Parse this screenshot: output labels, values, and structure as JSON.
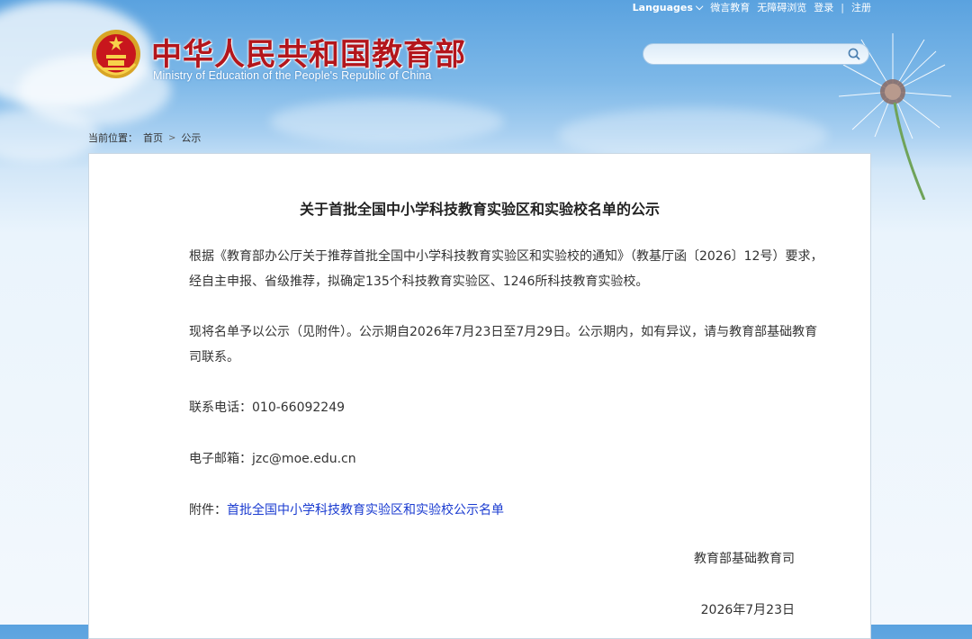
{
  "topbar": {
    "languages": "Languages",
    "weibo": "微言教育",
    "accessibility": "无障碍浏览",
    "login": "登录",
    "register": "注册"
  },
  "brand": {
    "name_cn": "中华人民共和国教育部",
    "name_en": "Ministry of Education of the People's Republic of China"
  },
  "search": {
    "placeholder": ""
  },
  "breadcrumb": {
    "prefix": "当前位置：",
    "home": "首页",
    "current": "公示"
  },
  "article": {
    "title": "关于首批全国中小学科技教育实验区和实验校名单的公示",
    "para1": "根据《教育部办公厅关于推荐首批全国中小学科技教育实验区和实验校的通知》（教基厅函〔2026〕12号）要求，经自主申报、省级推荐，拟确定135个科技教育实验区、1246所科技教育实验校。",
    "para2": "现将名单予以公示（见附件）。公示期自2026年7月23日至7月29日。公示期内，如有异议，请与教育部基础教育司联系。",
    "phone_label": "联系电话：",
    "phone": "010-66092249",
    "email_label": "电子邮箱：",
    "email": "jzc@moe.edu.cn",
    "attachment_label": "附件：",
    "attachment_link": "首批全国中小学科技教育实验区和实验校公示名单",
    "signature": "教育部基础教育司",
    "date": "2026年7月23日"
  },
  "colors": {
    "brand_red": "#b3161c",
    "link_blue": "#1a3bd0",
    "sky_blue": "#5aa2df"
  }
}
